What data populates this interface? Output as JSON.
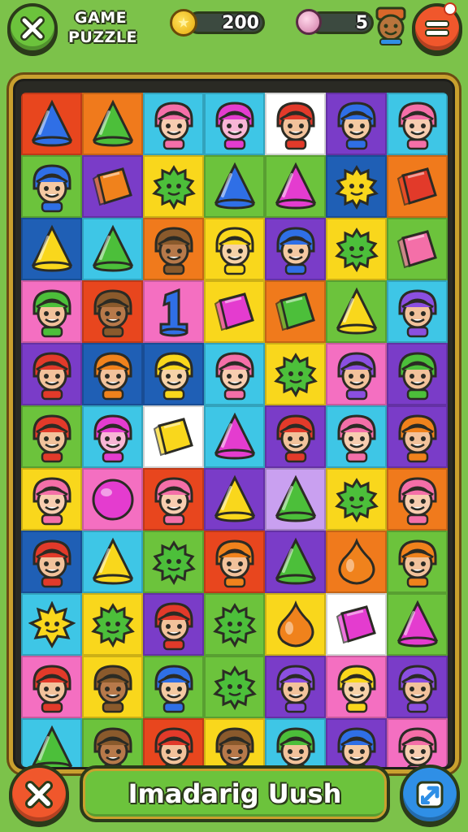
{
  "header": {
    "title_line1": "GAME",
    "title_line2": "PUZZLE",
    "coins": "200",
    "lives": "5",
    "icons": {
      "close": "close-x-icon",
      "coin": "coin-star-icon",
      "life": "pink-heart-gem-icon",
      "avatar": "player-avatar-icon",
      "menu": "menu-icon"
    }
  },
  "board": {
    "rows": 11,
    "cols": 7,
    "tiles": [
      [
        "cone-blue:#e8461e",
        "cone-green:#f07a1c",
        "face-pink:#3ec6e6",
        "face-magenta:#3ec6e6",
        "face-red:#ffffff",
        "face-blue:#7a3cc8",
        "face-pink:#3ec6e6"
      ],
      [
        "face-blue:#6cc33c",
        "cube-orange:#7a3cc8",
        "blob-green:#f9d71c",
        "cone-blue:#6cc33c",
        "cone-magenta:#6cc33c",
        "blob-yellow:#1f5fb5",
        "cube-red:#f07a1c"
      ],
      [
        "cone-yellow:#1f5fb5",
        "cone-green:#3ec6e6",
        "face-brown:#f07a1c",
        "face-yellow:#f9d71c",
        "face-blue:#7a3cc8",
        "blob-green:#f9d71c",
        "cube-pink:#6cc33c"
      ],
      [
        "face-green:#f46fc1",
        "face-brown:#e8461e",
        "one-blue:#f46fc1",
        "cube-magenta:#f9d71c",
        "cube-green:#f07a1c",
        "cone-yellow:#6cc33c",
        "face-purple:#3ec6e6"
      ],
      [
        "face-red:#7a3cc8",
        "face-orange:#1f5fb5",
        "face-yellow:#1f5fb5",
        "face-pink:#3ec6e6",
        "blob-green:#f9d71c",
        "face-purple:#f46fc1",
        "face-green:#7a3cc8"
      ],
      [
        "face-red:#6cc33c",
        "face-magenta:#3ec6e6",
        "cube-yellow:#ffffff",
        "cone-magenta:#3ec6e6",
        "face-red:#7a3cc8",
        "face-pink:#3ec6e6",
        "face-orange:#7a3cc8"
      ],
      [
        "face-pink:#f9d71c",
        "orb-magenta:#f46fc1",
        "face-pink:#e8461e",
        "cone-yellow:#7a3cc8",
        "cone-green:#c9a0f0",
        "blob-green:#f9d71c",
        "face-pink:#f07a1c"
      ],
      [
        "face-red:#1f5fb5",
        "cone-yellow:#3ec6e6",
        "blob-green:#6cc33c",
        "face-orange:#e8461e",
        "cone-green:#7a3cc8",
        "drop-orange:#f07a1c",
        "face-orange:#6cc33c"
      ],
      [
        "sun-yellow:#3ec6e6",
        "blob-green:#f9d71c",
        "face-red:#7a3cc8",
        "blob-green:#6cc33c",
        "drop-orange:#f9d71c",
        "cube-magenta:#ffffff",
        "cone-magenta:#6cc33c"
      ],
      [
        "face-red:#f46fc1",
        "face-brown:#f9d71c",
        "face-blue:#6cc33c",
        "blob-green:#6cc33c",
        "face-purple:#7a3cc8",
        "face-yellow:#f46fc1",
        "face-purple:#7a3cc8"
      ],
      [
        "cone-green:#3ec6e6",
        "face-brown:#6cc33c",
        "face-red:#e8461e",
        "face-brown:#f9d71c",
        "face-green:#3ec6e6",
        "face-blue:#7a3cc8",
        "face-pink:#f46fc1"
      ]
    ]
  },
  "footer": {
    "banner_text": "Imadarig Uush",
    "icons": {
      "cancel": "close-x-icon",
      "swap": "swap-arrow-icon"
    }
  }
}
